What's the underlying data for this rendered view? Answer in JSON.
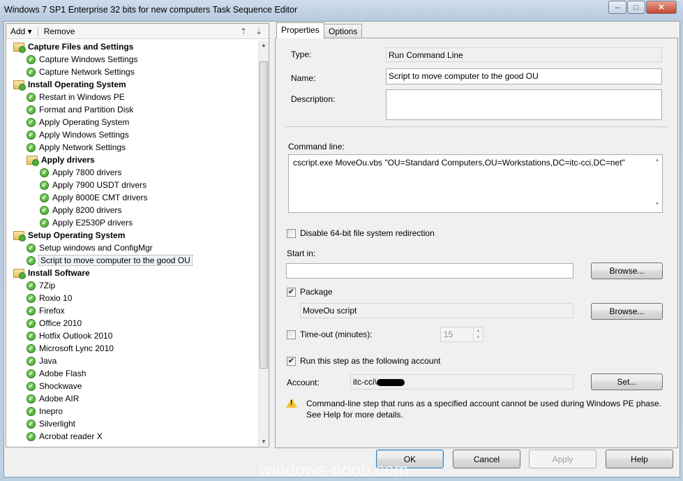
{
  "window": {
    "title": "Windows 7 SP1 Enterprise 32 bits for new computers Task Sequence Editor",
    "minimize": "–",
    "maximize": "□",
    "close": "✕"
  },
  "toolbar": {
    "add_label": "Add ▾",
    "remove_label": "Remove"
  },
  "tree": [
    {
      "label": "Capture Files and Settings",
      "type": "group",
      "level": 0
    },
    {
      "label": "Capture Windows Settings",
      "type": "step",
      "level": 1
    },
    {
      "label": "Capture Network Settings",
      "type": "step",
      "level": 1
    },
    {
      "label": "Install Operating System",
      "type": "group",
      "level": 0
    },
    {
      "label": "Restart in Windows PE",
      "type": "step",
      "level": 1
    },
    {
      "label": "Format and Partition Disk",
      "type": "step",
      "level": 1
    },
    {
      "label": "Apply Operating System",
      "type": "step",
      "level": 1
    },
    {
      "label": "Apply Windows Settings",
      "type": "step",
      "level": 1
    },
    {
      "label": "Apply Network Settings",
      "type": "step",
      "level": 1
    },
    {
      "label": "Apply drivers",
      "type": "group",
      "level": 1
    },
    {
      "label": "Apply 7800 drivers",
      "type": "step",
      "level": 2
    },
    {
      "label": "Apply 7900 USDT drivers",
      "type": "step",
      "level": 2
    },
    {
      "label": "Apply 8000E CMT drivers",
      "type": "step",
      "level": 2
    },
    {
      "label": "Apply 8200 drivers",
      "type": "step",
      "level": 2
    },
    {
      "label": "Apply E2530P drivers",
      "type": "step",
      "level": 2
    },
    {
      "label": "Setup Operating System",
      "type": "group",
      "level": 0
    },
    {
      "label": "Setup windows and ConfigMgr",
      "type": "step",
      "level": 1
    },
    {
      "label": "Script to move computer to the good OU",
      "type": "step",
      "level": 1,
      "selected": true
    },
    {
      "label": "Install Software",
      "type": "group",
      "level": 0
    },
    {
      "label": "7Zip",
      "type": "step",
      "level": 1
    },
    {
      "label": "Roxio 10",
      "type": "step",
      "level": 1
    },
    {
      "label": "Firefox",
      "type": "step",
      "level": 1
    },
    {
      "label": "Office 2010",
      "type": "step",
      "level": 1
    },
    {
      "label": "Hotfix Outlook 2010",
      "type": "step",
      "level": 1
    },
    {
      "label": "Microsoft Lync 2010",
      "type": "step",
      "level": 1
    },
    {
      "label": "Java",
      "type": "step",
      "level": 1
    },
    {
      "label": "Adobe Flash",
      "type": "step",
      "level": 1
    },
    {
      "label": "Shockwave",
      "type": "step",
      "level": 1
    },
    {
      "label": "Adobe AIR",
      "type": "step",
      "level": 1
    },
    {
      "label": "Inepro",
      "type": "step",
      "level": 1
    },
    {
      "label": "Silverlight",
      "type": "step",
      "level": 1
    },
    {
      "label": "Acrobat reader X",
      "type": "step",
      "level": 1
    }
  ],
  "tabs": {
    "properties": "Properties",
    "options": "Options"
  },
  "props": {
    "type_label": "Type:",
    "type_value": "Run Command Line",
    "name_label": "Name:",
    "name_value": "Script to move computer to the good OU",
    "description_label": "Description:",
    "description_value": "",
    "command_label": "Command line:",
    "command_value": "cscript.exe MoveOu.vbs \"OU=Standard Computers,OU=Workstations,DC=itc-cci,DC=net\"",
    "disable64_label": "Disable 64-bit file system redirection",
    "disable64_checked": false,
    "startin_label": "Start in:",
    "startin_value": "",
    "browse1": "Browse...",
    "package_label": "Package",
    "package_checked": true,
    "package_value": "MoveOu script",
    "browse2": "Browse...",
    "timeout_label": "Time-out (minutes):",
    "timeout_checked": false,
    "timeout_value": "15",
    "runas_label": "Run this step as the following account",
    "runas_checked": true,
    "account_label": "Account:",
    "account_value": "itc-cci\\",
    "set_button": "Set...",
    "warning_line1": "Command-line step that runs as a specified account cannot be used during Windows PE phase.",
    "warning_line2": "See Help for more details."
  },
  "buttons": {
    "ok": "OK",
    "cancel": "Cancel",
    "apply": "Apply",
    "help": "Help"
  },
  "watermark": "windows-noob.com"
}
